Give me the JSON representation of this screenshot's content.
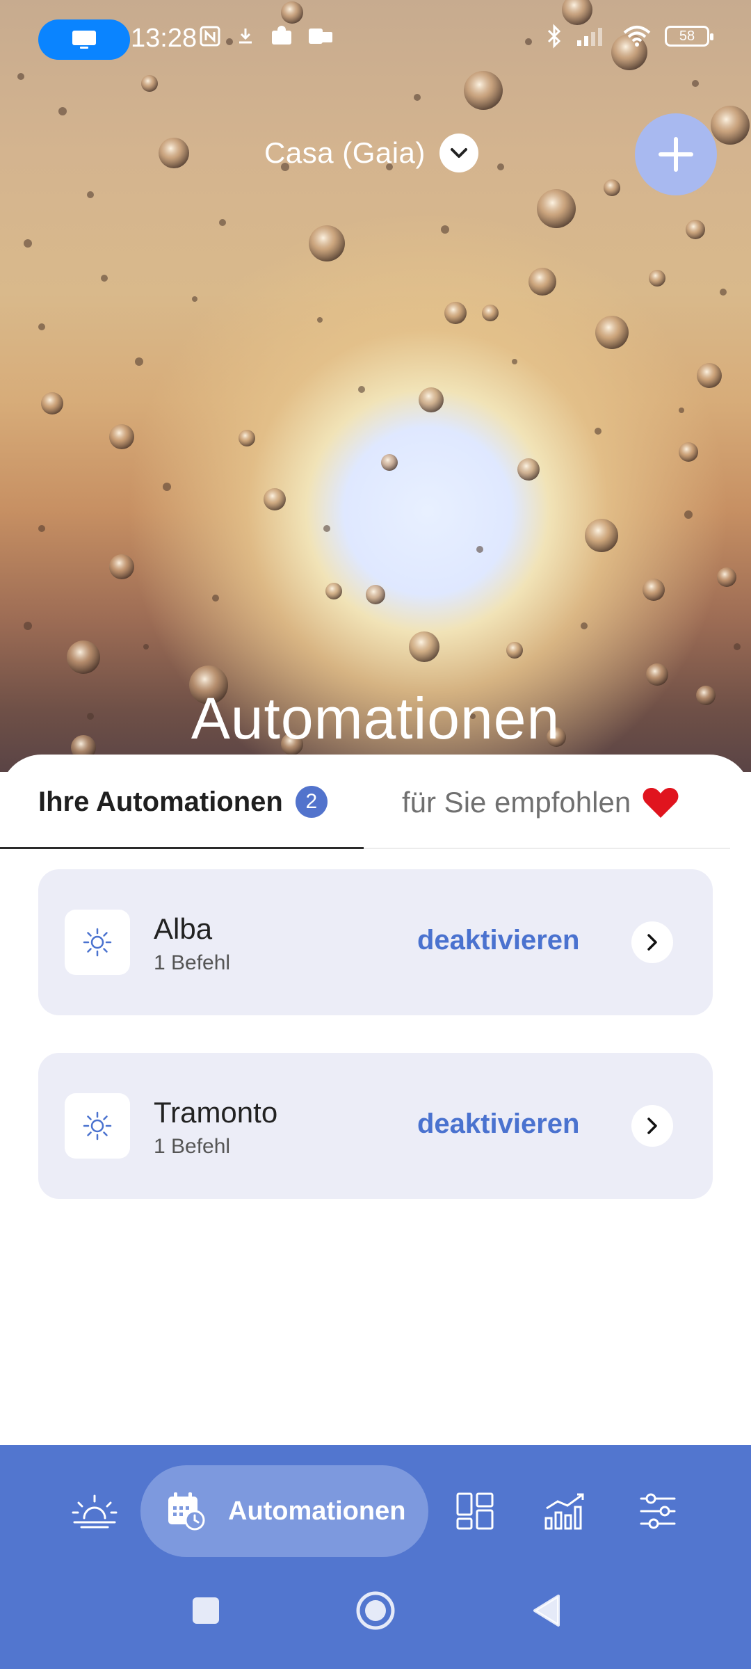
{
  "status_bar": {
    "time": "13:28",
    "battery": "58"
  },
  "header": {
    "home_name": "Casa (Gaia)",
    "title": "Automationen"
  },
  "tabs": {
    "active_label": "Ihre Automationen",
    "active_count": "2",
    "inactive_label": "für Sie empfohlen"
  },
  "automations": [
    {
      "name": "Alba",
      "commands": "1 Befehl",
      "action": "deaktivieren",
      "icon": "sun-icon"
    },
    {
      "name": "Tramonto",
      "commands": "1 Befehl",
      "action": "deaktivieren",
      "icon": "sun-icon"
    }
  ],
  "bottom_nav": {
    "items": [
      {
        "icon": "sunrise-icon"
      },
      {
        "icon": "calendar-clock-icon",
        "label": "Automationen",
        "active": true
      },
      {
        "icon": "grid-icon"
      },
      {
        "icon": "chart-icon"
      },
      {
        "icon": "sliders-icon"
      }
    ]
  },
  "colors": {
    "accent": "#5276cf",
    "link": "#4a72cf",
    "card_bg": "#ecedf7",
    "heart": "#e0141e"
  }
}
